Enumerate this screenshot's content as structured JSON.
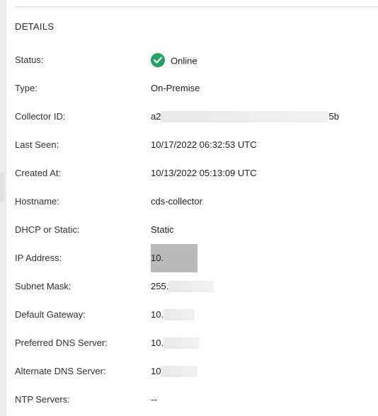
{
  "section_title": "DETAILS",
  "colors": {
    "online_green": "#1fa463",
    "panel_bg": "#ffffff",
    "text": "#2b2b2b"
  },
  "fields": [
    {
      "label": "Status:",
      "value": "Online",
      "icon": "check-circle-icon"
    },
    {
      "label": "Type:",
      "value": "On-Premise"
    },
    {
      "label": "Collector ID:",
      "value_start": "a2",
      "value_end": "5b"
    },
    {
      "label": "Last Seen:",
      "value": "10/17/2022 06:32:53 UTC"
    },
    {
      "label": "Created At:",
      "value": "10/13/2022 05:13:09 UTC"
    },
    {
      "label": "Hostname:",
      "value": "cds-collector"
    },
    {
      "label": "DHCP or Static:",
      "value": "Static"
    },
    {
      "label": "IP Address:",
      "value": "10."
    },
    {
      "label": "Subnet Mask:",
      "value": "255."
    },
    {
      "label": "Default Gateway:",
      "value": "10."
    },
    {
      "label": "Preferred DNS Server:",
      "value": "10."
    },
    {
      "label": "Alternate DNS Server:",
      "value": "10"
    },
    {
      "label": "NTP Servers:",
      "value": "--"
    }
  ]
}
